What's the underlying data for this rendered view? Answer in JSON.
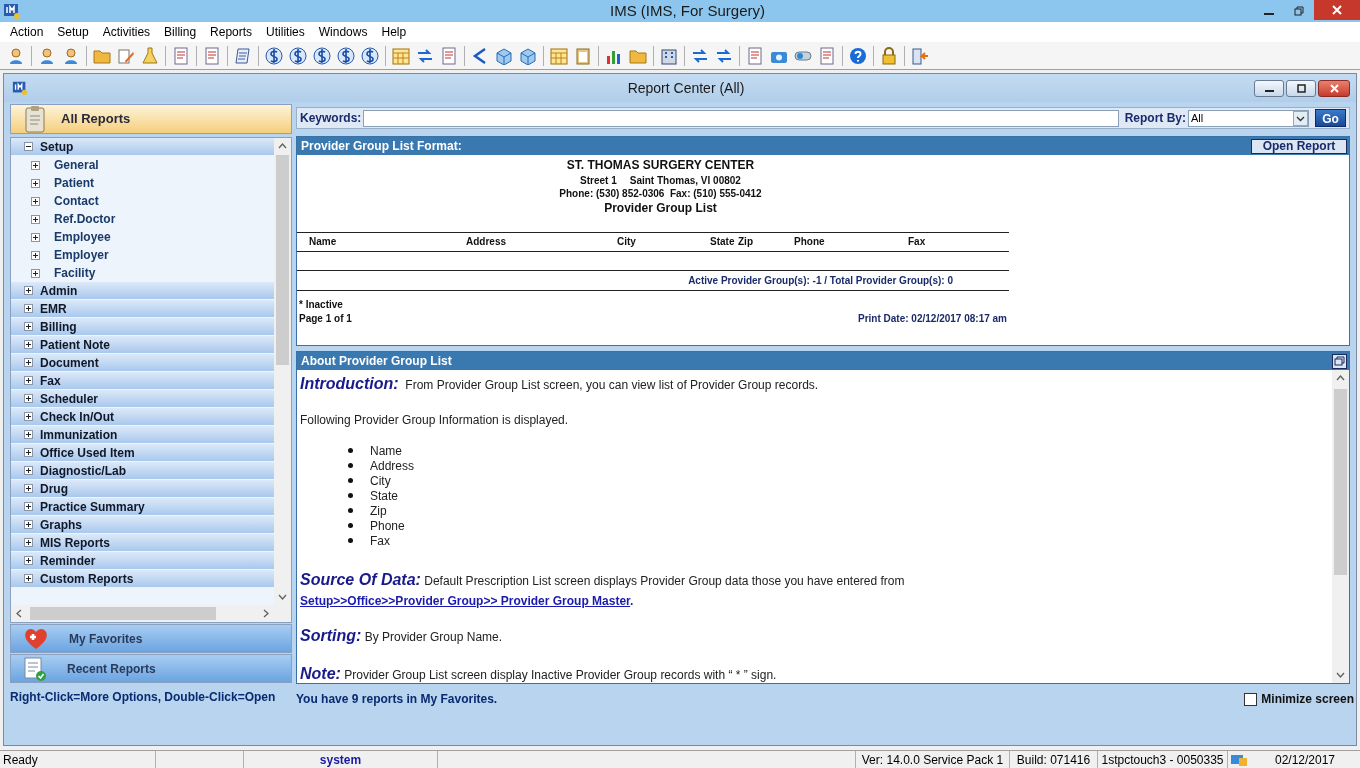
{
  "window": {
    "title": "IMS (IMS, For Surgery)"
  },
  "menu": [
    "Action",
    "Setup",
    "Activities",
    "Billing",
    "Reports",
    "Utilities",
    "Windows",
    "Help"
  ],
  "report_center": {
    "title": "Report Center (All)"
  },
  "sidebar": {
    "header": "All Reports",
    "tree": [
      {
        "label": "Setup",
        "expanded": true,
        "children": [
          {
            "label": "General",
            "expanded": false
          },
          {
            "label": "Patient",
            "expanded": false
          },
          {
            "label": "Contact",
            "expanded": false
          },
          {
            "label": "Ref.Doctor",
            "expanded": false
          },
          {
            "label": "Employee",
            "expanded": false
          },
          {
            "label": "Employer",
            "expanded": false
          },
          {
            "label": "Facility",
            "expanded": false
          }
        ]
      },
      {
        "label": "Admin",
        "expanded": false
      },
      {
        "label": "EMR",
        "expanded": false
      },
      {
        "label": "Billing",
        "expanded": false
      },
      {
        "label": "Patient Note",
        "expanded": false
      },
      {
        "label": "Document",
        "expanded": false
      },
      {
        "label": "Fax",
        "expanded": false
      },
      {
        "label": "Scheduler",
        "expanded": false
      },
      {
        "label": "Check In/Out",
        "expanded": false
      },
      {
        "label": "Immunization",
        "expanded": false
      },
      {
        "label": "Office Used Item",
        "expanded": false
      },
      {
        "label": "Diagnostic/Lab",
        "expanded": false
      },
      {
        "label": "Drug",
        "expanded": false
      },
      {
        "label": "Practice Summary",
        "expanded": false
      },
      {
        "label": "Graphs",
        "expanded": false
      },
      {
        "label": "MIS Reports",
        "expanded": false
      },
      {
        "label": "Reminder",
        "expanded": false
      },
      {
        "label": "Custom Reports",
        "expanded": false
      }
    ],
    "sections": [
      {
        "label": "My Favorites",
        "kind": "favorites"
      },
      {
        "label": "Recent Reports",
        "kind": "recent"
      }
    ],
    "hint": "Right-Click=More Options, Double-Click=Open"
  },
  "search": {
    "keywords_label": "Keywords:",
    "report_by_label": "Report By:",
    "report_by_value": "All",
    "go": "Go"
  },
  "preview": {
    "header": "Provider Group List Format:",
    "open_button": "Open Report",
    "org": "ST. THOMAS SURGERY CENTER",
    "street": "Street 1",
    "city": "Saint Thomas, VI 00802",
    "phone": "Phone: (530) 852-0306  Fax: (510) 555-0412",
    "title": "Provider Group List",
    "columns": [
      "Name",
      "Address",
      "City",
      "State",
      "Zip",
      "Phone",
      "Fax"
    ],
    "summary": "Active Provider Group(s): -1 / Total Provider Group(s): 0",
    "inactive_note": "* Inactive",
    "page": "Page 1 of 1",
    "print_date": "Print Date: 02/12/2017 08:17 am"
  },
  "about": {
    "header": "About Provider Group List",
    "intro_heading": "Introduction:",
    "intro_text": "From Provider Group List screen, you can view list of Provider Group records.",
    "info_line": "Following Provider Group Information is displayed.",
    "fields": [
      "Name",
      "Address",
      "City",
      "State",
      "Zip",
      "Phone",
      "Fax"
    ],
    "source_heading": "Source Of Data:",
    "source_text": "Default Prescription List screen displays Provider Group data those you have entered from",
    "source_link": "Setup>>Office>>Provider Group>> Provider Group Master",
    "source_end": ".",
    "sorting_heading": "Sorting:",
    "sorting_text": "By Provider Group Name.",
    "note_heading": "Note:",
    "note_text": "Provider Group List screen display Inactive Provider Group records with “ * ” sign."
  },
  "favorites_note": "You have 9 reports in My Favorites.",
  "minimize_screen": {
    "label": "Minimize screen",
    "checked": false
  },
  "status_bar": {
    "state": "Ready",
    "user": "system",
    "version": "Ver: 14.0.0 Service Pack 1",
    "build": "Build: 071416",
    "station": "1stpctouch3 - 0050335",
    "date": "02/12/2017"
  }
}
